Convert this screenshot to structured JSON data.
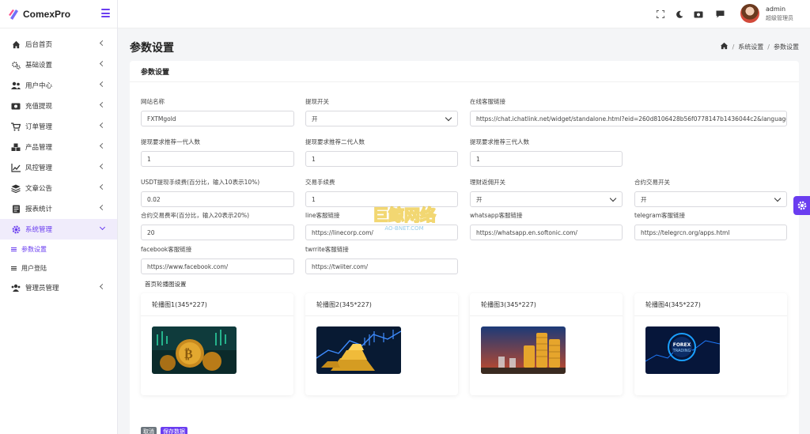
{
  "brand": {
    "name": "ComexPro"
  },
  "sidebar": {
    "items": [
      {
        "label": "后台首页",
        "icon": "home-icon"
      },
      {
        "label": "基础设置",
        "icon": "cogs-icon"
      },
      {
        "label": "用户中心",
        "icon": "users-icon"
      },
      {
        "label": "充值提现",
        "icon": "money-icon"
      },
      {
        "label": "订单管理",
        "icon": "cart-icon"
      },
      {
        "label": "产品管理",
        "icon": "cubes-icon"
      },
      {
        "label": "风控管理",
        "icon": "chart-line-icon"
      },
      {
        "label": "文章公告",
        "icon": "layers-icon"
      },
      {
        "label": "报表统计",
        "icon": "report-icon"
      },
      {
        "label": "系统管理",
        "icon": "gear-icon"
      }
    ],
    "sub_items": [
      {
        "label": "参数设置"
      },
      {
        "label": "用户登陆"
      }
    ],
    "last_item": {
      "label": "管理员管理",
      "icon": "admins-icon"
    }
  },
  "header": {
    "user_name": "admin",
    "user_role": "超级管理员"
  },
  "page": {
    "title": "参数设置",
    "breadcrumb": [
      "系统设置",
      "参数设置"
    ]
  },
  "card": {
    "title": "参数设置",
    "fields": {
      "site_name": {
        "label": "网站名称",
        "value": "FXTMgold"
      },
      "withdraw_switch": {
        "label": "提现开关",
        "value": "开"
      },
      "support_link": {
        "label": "在线客服链接",
        "value": "https://chat.ichatlink.net/widget/standalone.html?eid=260d8106428b56f0778147b1436044c2&language=t"
      },
      "req_gen1": {
        "label": "提现要求推荐一代人数",
        "value": "1"
      },
      "req_gen2": {
        "label": "提现要求推荐二代人数",
        "value": "1"
      },
      "req_gen3": {
        "label": "提现要求推荐三代人数",
        "value": "1"
      },
      "usdt_fee": {
        "label": "USDT提现手续费(百分比，输入10表示10%)",
        "value": "0.02"
      },
      "trade_fee": {
        "label": "交易手续费",
        "value": "1"
      },
      "finance_rebate": {
        "label": "理财返佣开关",
        "value": "开"
      },
      "contract_switch": {
        "label": "合约交易开关",
        "value": "开"
      },
      "contract_fee": {
        "label": "合约交易费率(百分比，输入20表示20%)",
        "value": "20"
      },
      "line_link": {
        "label": "line客服链接",
        "value": "https://linecorp.com/"
      },
      "whatsapp_link": {
        "label": "whatsapp客服链接",
        "value": "https://whatsapp.en.softonic.com/"
      },
      "telegram_link": {
        "label": "telegram客服链接",
        "value": "https://telegrcn.org/apps.html"
      },
      "facebook_link": {
        "label": "facebook客服链接",
        "value": "https://www.facebook.com/"
      },
      "twitter_link": {
        "label": "twrrite客服链接",
        "value": "https://twiiter.com/"
      }
    },
    "banner_section_label": "首页轮播图设置",
    "banners": [
      {
        "title": "轮播图1(345*227)"
      },
      {
        "title": "轮播图2(345*227)"
      },
      {
        "title": "轮播图3(345*227)"
      },
      {
        "title": "轮播图4(345*227)",
        "image_text": "FOREX\nTRADING"
      }
    ],
    "buttons": {
      "cancel": "取消",
      "save": "保存数据"
    }
  },
  "watermark": {
    "text": "巨鲸网络",
    "sub": "AO-BNET.COM"
  },
  "colors": {
    "accent": "#6a3df0",
    "cancel": "#6c757d"
  }
}
